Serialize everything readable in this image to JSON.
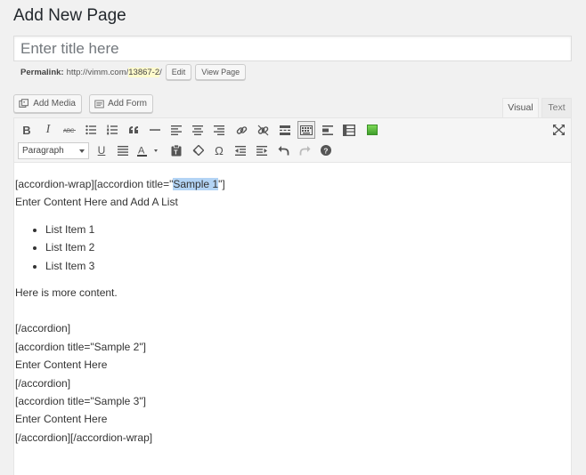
{
  "page": {
    "title": "Add New Page"
  },
  "title_input": {
    "placeholder": "Enter title here",
    "value": ""
  },
  "permalink": {
    "label": "Permalink:",
    "base": "http://vimm.com/",
    "slug": "13867-2",
    "suffix": "/",
    "edit_label": "Edit",
    "view_label": "View Page"
  },
  "media_buttons": {
    "add_media": "Add Media",
    "add_form": "Add Form"
  },
  "tabs": {
    "visual": "Visual",
    "text": "Text",
    "active": "Visual"
  },
  "toolbar": {
    "row1": [
      "bold-icon",
      "italic-icon",
      "strikethrough-icon",
      "bullet-list-icon",
      "numbered-list-icon",
      "blockquote-icon",
      "horizontal-rule-icon",
      "align-left-icon",
      "align-center-icon",
      "align-right-icon",
      "link-icon",
      "unlink-icon",
      "insert-more-icon",
      "toolbar-toggle-icon",
      "accordion-icon",
      "form-icon",
      "green-square-icon",
      "fullscreen-icon"
    ],
    "row2": [
      "format-select",
      "underline-icon",
      "justify-icon",
      "text-color-icon",
      "paste-text-icon",
      "clear-formatting-icon",
      "special-char-icon",
      "outdent-icon",
      "indent-icon",
      "undo-icon",
      "redo-icon",
      "help-icon"
    ],
    "format_value": "Paragraph",
    "accent_green": "#5cb85c"
  },
  "content": {
    "line1_prefix": "[accordion-wrap][accordion title=\"",
    "line1_highlight": "Sample 1",
    "line1_suffix": "\"]",
    "line2": "Enter Content Here and Add A List",
    "list": [
      "List Item 1",
      "List Item 2",
      "List Item 3"
    ],
    "line3": "Here is more content.",
    "lines_after": [
      "[/accordion]",
      "[accordion title=\"Sample 2\"]",
      "Enter Content Here",
      "[/accordion]",
      "[accordion title=\"Sample 3\"]",
      "Enter Content Here",
      "[/accordion][/accordion-wrap]"
    ]
  }
}
